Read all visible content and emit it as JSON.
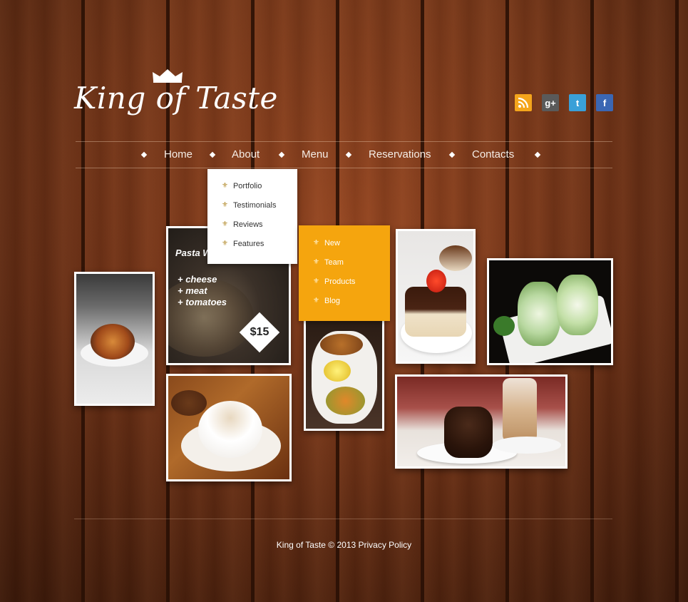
{
  "brand": {
    "logo_text": "King of Taste"
  },
  "social": {
    "icons": [
      "rss-icon",
      "google-plus-icon",
      "twitter-icon",
      "facebook-icon"
    ]
  },
  "nav": {
    "items": [
      {
        "label": "Home"
      },
      {
        "label": "About"
      },
      {
        "label": "Menu"
      },
      {
        "label": "Reservations"
      },
      {
        "label": "Contacts"
      }
    ]
  },
  "about_submenu": {
    "items": [
      {
        "label": "Portfolio"
      },
      {
        "label": "Testimonials"
      },
      {
        "label": "Reviews"
      },
      {
        "label": "Features"
      }
    ]
  },
  "menu_submenu": {
    "items": [
      {
        "label": "New"
      },
      {
        "label": "Team"
      },
      {
        "label": "Products"
      },
      {
        "label": "Blog"
      }
    ]
  },
  "feature": {
    "title": "Pasta With Bolognese",
    "ingredients": [
      "+ cheese",
      "+ meat",
      "+ tomatoes"
    ],
    "price": "$15"
  },
  "footer": {
    "text": "King of Taste © 2013 Privacy Policy"
  },
  "colors": {
    "accent_orange": "#f5a50e",
    "wood_dark": "#6b3318",
    "text_light": "#f5ede6"
  }
}
